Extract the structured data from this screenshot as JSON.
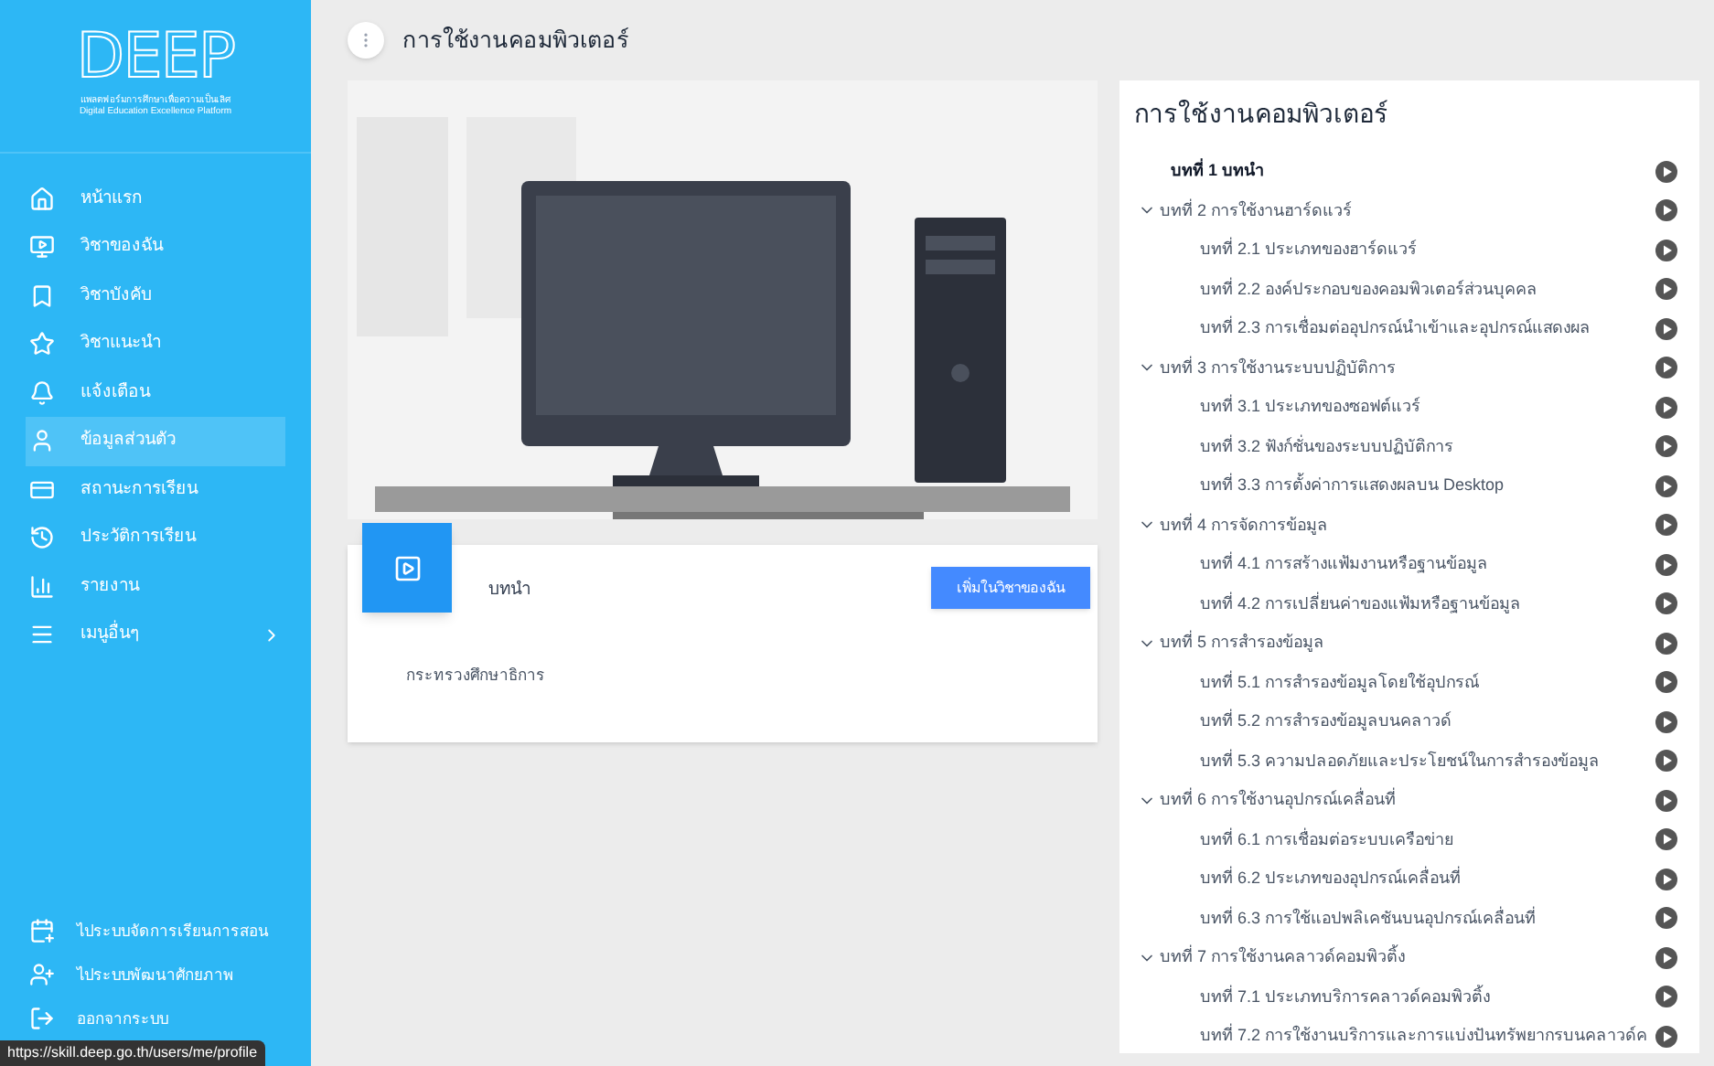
{
  "sidebar": {
    "logo": "DEEP",
    "logo_subtitle_th": "แพลตฟอร์มการศึกษาเพื่อความเป็นเลิศ",
    "logo_subtitle_en": "Digital Education Excellence Platform",
    "items": [
      {
        "label": "หน้าแรก",
        "selected": false
      },
      {
        "label": "วิชาของฉัน",
        "selected": false
      },
      {
        "label": "วิชาบังคับ",
        "selected": false
      },
      {
        "label": "วิชาแนะนำ",
        "selected": false
      },
      {
        "label": "แจ้งเตือน",
        "selected": false
      },
      {
        "label": "ข้อมูลส่วนตัว",
        "selected": true
      },
      {
        "label": "สถานะการเรียน",
        "selected": false
      },
      {
        "label": "ประวัติการเรียน",
        "selected": false
      },
      {
        "label": "รายงาน",
        "selected": false
      },
      {
        "label": "เมนูอื่นๆ",
        "selected": false,
        "expanded": false
      }
    ],
    "bottom_items": [
      {
        "label": "ไประบบจัดการเรียนการสอน"
      },
      {
        "label": "ไประบบพัฒนาศักยภาพ"
      },
      {
        "label": "ออกจากระบบ"
      }
    ]
  },
  "status_url": "https://skill.deep.go.th/users/me/profile",
  "header": {
    "title": "การใช้งานคอมพิวเตอร์"
  },
  "lesson_card": {
    "title": "บทนำ",
    "button": "เพิ่มในวิชาของฉัน",
    "publisher": "กระทรวงศึกษาธิการ"
  },
  "outline": {
    "title": "การใช้งานคอมพิวเตอร์",
    "items": [
      {
        "label": "บทที่ 1 บทนำ",
        "selected": true
      },
      {
        "label": "บทที่ 2 การใช้งานฮาร์ดแวร์",
        "selected": false,
        "expanded": true,
        "children": [
          {
            "label": "บทที่ 2.1 ประเภทของฮาร์ดแวร์",
            "selected": false
          },
          {
            "label": "บทที่ 2.2 องค์ประกอบของคอมพิวเตอร์ส่วนบุคคล",
            "selected": false
          },
          {
            "label": "บทที่ 2.3 การเชื่อมต่ออุปกรณ์นำเข้าและอุปกรณ์แสดงผล",
            "selected": false
          }
        ]
      },
      {
        "label": "บทที่ 3 การใช้งานระบบปฏิบัติการ",
        "selected": false,
        "expanded": true,
        "children": [
          {
            "label": "บทที่ 3.1 ประเภทของซอฟต์แวร์",
            "selected": false
          },
          {
            "label": "บทที่ 3.2 ฟังก์ชั่นของระบบปฏิบัติการ",
            "selected": false
          },
          {
            "label": "บทที่ 3.3 การตั้งค่าการแสดงผลบน Desktop",
            "selected": false
          }
        ]
      },
      {
        "label": "บทที่ 4 การจัดการข้อมูล",
        "selected": false,
        "expanded": true,
        "children": [
          {
            "label": "บทที่ 4.1 การสร้างแฟ้มงานหรือฐานข้อมูล",
            "selected": false
          },
          {
            "label": "บทที่ 4.2 การเปลี่ยนค่าของแฟ้มหรือฐานข้อมูล",
            "selected": false
          }
        ]
      },
      {
        "label": "บทที่ 5 การสำรองข้อมูล",
        "selected": false,
        "expanded": true,
        "children": [
          {
            "label": "บทที่ 5.1 การสำรองข้อมูลโดยใช้อุปกรณ์",
            "selected": false
          },
          {
            "label": "บทที่ 5.2 การสำรองข้อมูลบนคลาวด์",
            "selected": false
          },
          {
            "label": "บทที่ 5.3 ความปลอดภัยและประโยชน์ในการสำรองข้อมูล",
            "selected": false
          }
        ]
      },
      {
        "label": "บทที่ 6 การใช้งานอุปกรณ์เคลื่อนที่",
        "selected": false,
        "expanded": true,
        "children": [
          {
            "label": "บทที่ 6.1 การเชื่อมต่อระบบเครือข่าย",
            "selected": false
          },
          {
            "label": "บทที่ 6.2 ประเภทของอุปกรณ์เคลื่อนที่",
            "selected": false
          },
          {
            "label": "บทที่ 6.3 การใช้แอปพลิเคชันบนอุปกรณ์เคลื่อนที่",
            "selected": false
          }
        ]
      },
      {
        "label": "บทที่ 7 การใช้งานคลาวด์คอมพิวติ้ง",
        "selected": false,
        "expanded": true,
        "children": [
          {
            "label": "บทที่ 7.1 ประเภทบริการคลาวด์คอมพิวติ้ง",
            "selected": false
          },
          {
            "label": "บทที่ 7.2 การใช้งานบริการและการแบ่งปันทรัพยากรบนคลาวด์ค",
            "selected": false
          }
        ]
      }
    ]
  }
}
